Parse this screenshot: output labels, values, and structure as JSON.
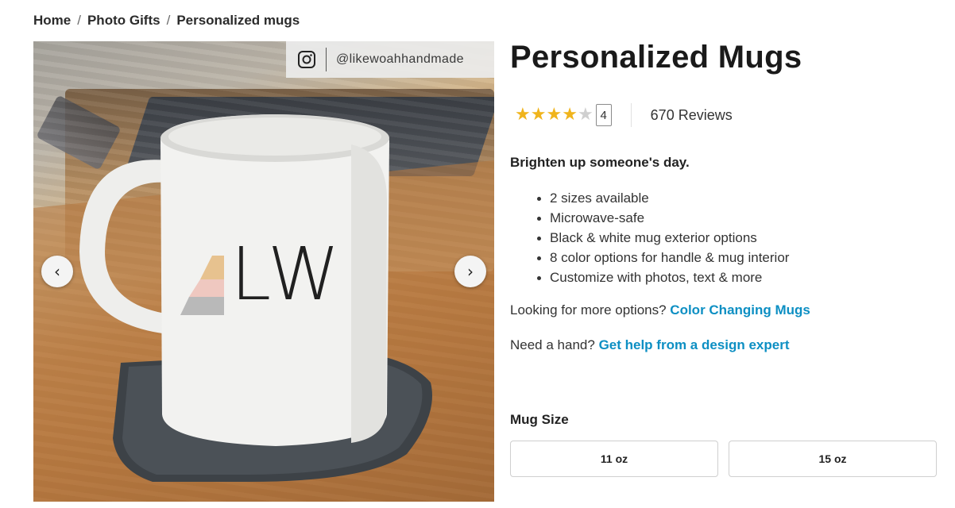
{
  "breadcrumb": {
    "items": [
      "Home",
      "Photo Gifts",
      "Personalized mugs"
    ],
    "separator": "/"
  },
  "gallery": {
    "instagram_handle": "@likewoahhandmade",
    "mug_monogram": "LW",
    "prev_icon": "‹",
    "next_icon": "›"
  },
  "product": {
    "title": "Personalized Mugs",
    "rating": {
      "stars_filled": 4,
      "stars_total": 5,
      "value_label": "4",
      "reviews": "670 Reviews"
    },
    "tagline": "Brighten up someone's day.",
    "features": [
      "2 sizes available",
      "Microwave-safe",
      "Black & white mug exterior options",
      "8 color options for handle & mug interior",
      "Customize with photos, text & more"
    ],
    "more_options": {
      "prefix": "Looking for more options?",
      "link": "Color Changing Mugs"
    },
    "help": {
      "prefix": "Need a hand?",
      "link": "Get help from a design expert"
    },
    "size": {
      "label": "Mug Size",
      "options": [
        "11 oz",
        "15 oz"
      ]
    }
  },
  "colors": {
    "link": "#0d8fc3",
    "star": "#f0b41c",
    "star_empty": "#cfcfcf"
  }
}
